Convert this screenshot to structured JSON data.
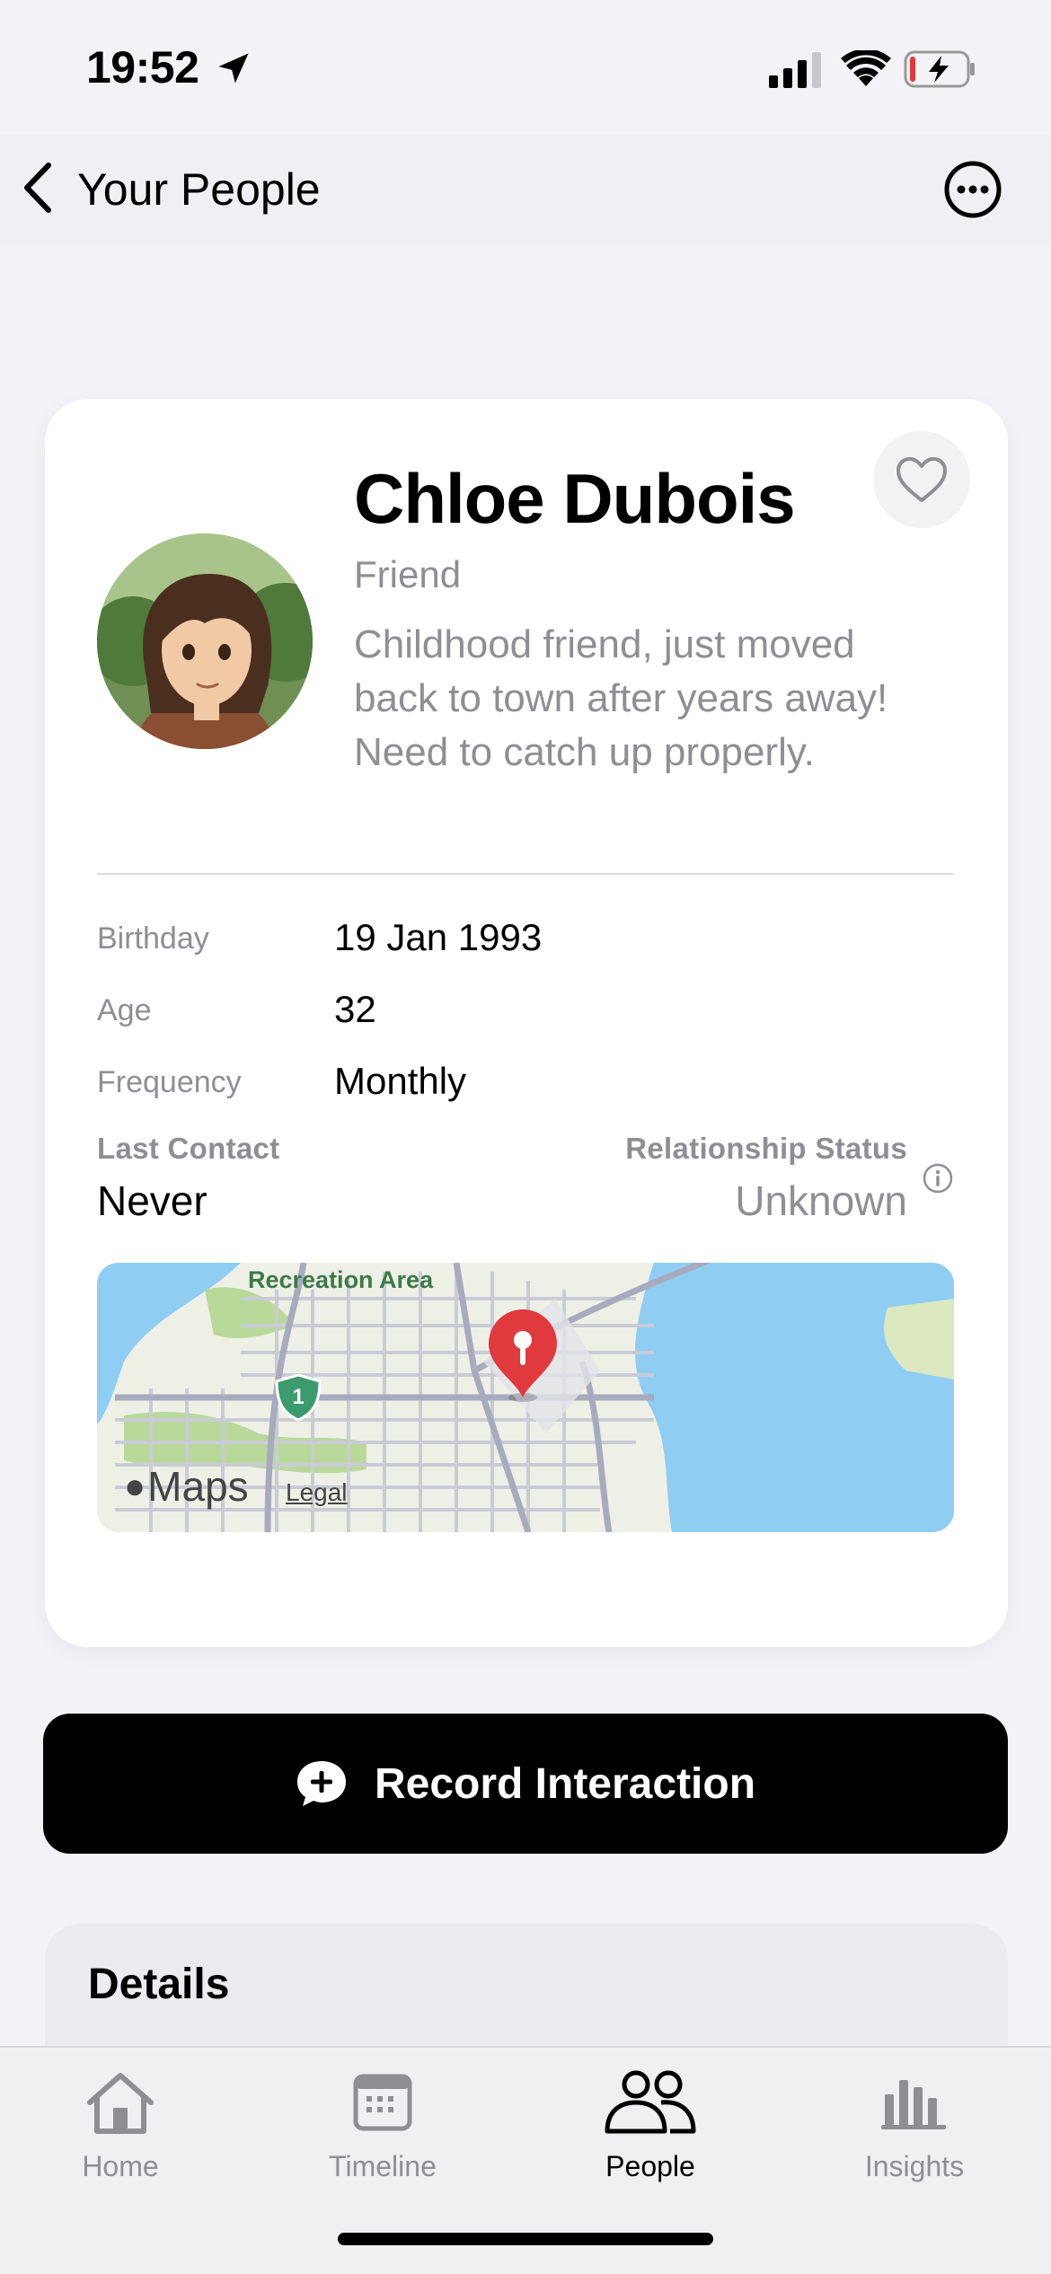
{
  "status_bar": {
    "time": "19:52"
  },
  "nav": {
    "back_label": "Your People"
  },
  "profile": {
    "name": "Chloe Dubois",
    "relation": "Friend",
    "bio": "Childhood friend, just moved back to town after years away! Need to catch up properly."
  },
  "info": {
    "birthday_label": "Birthday",
    "birthday_value": "19 Jan 1993",
    "age_label": "Age",
    "age_value": "32",
    "frequency_label": "Frequency",
    "frequency_value": "Monthly",
    "last_contact_label": "Last Contact",
    "last_contact_value": "Never",
    "relationship_status_label": "Relationship Status",
    "relationship_status_value": "Unknown"
  },
  "map": {
    "area_label": "Recreation Area",
    "route_number": "1",
    "logo_text": "Maps",
    "legal_label": "Legal"
  },
  "actions": {
    "record_label": "Record Interaction"
  },
  "details": {
    "title": "Details"
  },
  "tabs": [
    {
      "label": "Home",
      "icon": "house-icon"
    },
    {
      "label": "Timeline",
      "icon": "calendar-icon"
    },
    {
      "label": "People",
      "icon": "people-icon",
      "active": true
    },
    {
      "label": "Insights",
      "icon": "chart-bars-icon"
    }
  ],
  "colors": {
    "accent": "#000000",
    "secondary_text": "#8e8e93",
    "map_pin": "#e0393e"
  }
}
